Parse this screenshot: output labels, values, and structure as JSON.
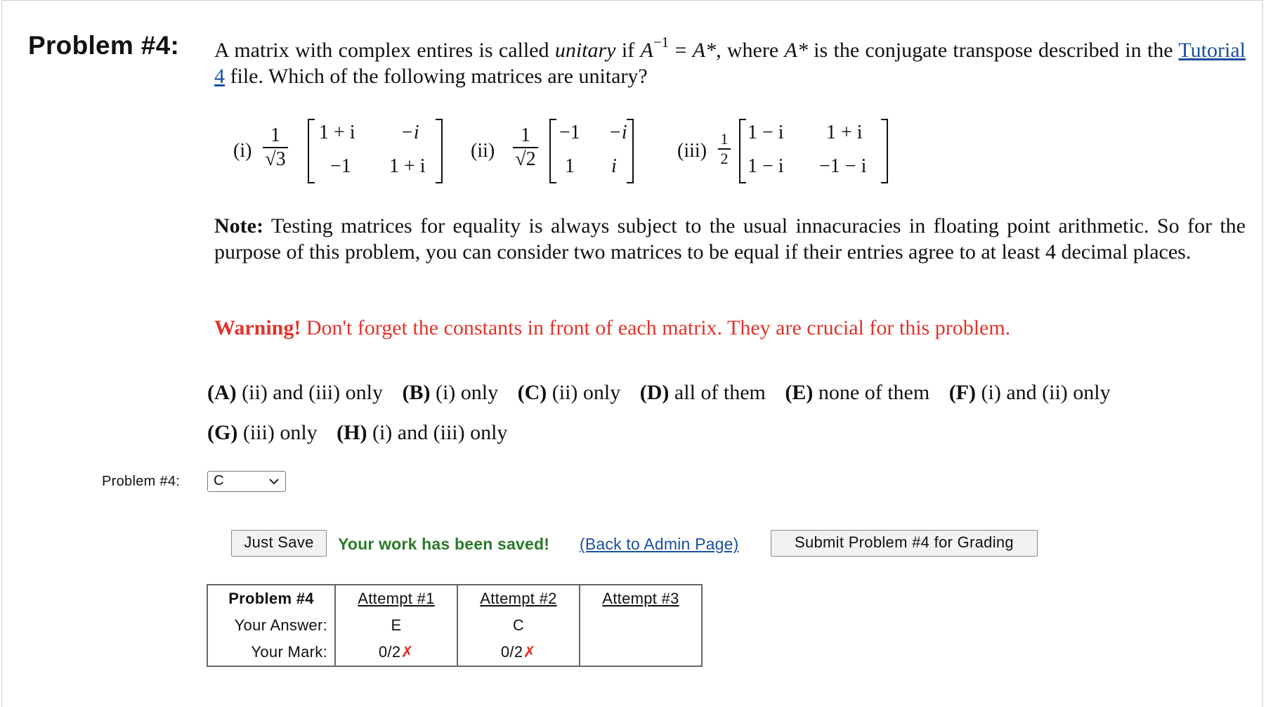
{
  "problem": {
    "label": "Problem #4:",
    "statement": {
      "p1": "A matrix with complex entires is called ",
      "unitary_word": "unitary",
      "p2": " if ",
      "A": "A",
      "inv_exp": "−1",
      "p3": " = ",
      "Astar1": "A*",
      "p4": ", where ",
      "Astar2": "A*",
      "p5": " is the conjugate transpose described in the ",
      "link": "Tutorial 4",
      "p6": " file. Which of the following matrices are unitary?"
    }
  },
  "matrices": [
    {
      "label": "(i)",
      "num": "1",
      "den": "√3",
      "cells": [
        "1 + i",
        "−i",
        "−1",
        "1 + i"
      ]
    },
    {
      "label": "(ii)",
      "num": "1",
      "den": "√2",
      "cells": [
        "−1",
        "−i",
        "1",
        "i"
      ]
    },
    {
      "label": "(iii)",
      "num": "1",
      "den": "2",
      "cells": [
        "1 − i",
        "1 + i",
        "1 − i",
        "−1 − i"
      ]
    }
  ],
  "note": {
    "bold": "Note:",
    "text": " Testing matrices for equality is always subject to the usual innacuracies in floating point arithmetic. So for the purpose of this problem, you can consider two matrices to be equal if their entries agree to at least 4 decimal places."
  },
  "warning": {
    "bold": "Warning!",
    "text": " Don't forget the constants in front of each matrix. They are crucial for this problem."
  },
  "choices": {
    "line1": [
      {
        "key": "(A)",
        "text": "(ii) and (iii) only"
      },
      {
        "key": "(B)",
        "text": "(i) only"
      },
      {
        "key": "(C)",
        "text": "(ii) only"
      },
      {
        "key": "(D)",
        "text": "all of them"
      },
      {
        "key": "(E)",
        "text": "none of them"
      },
      {
        "key": "(F)",
        "text": "(i) and (ii) only"
      }
    ],
    "line2": [
      {
        "key": "(G)",
        "text": "(iii) only"
      },
      {
        "key": "(H)",
        "text": "(i) and (iii) only"
      }
    ]
  },
  "answer": {
    "label": "Problem #4:",
    "selected": "C"
  },
  "actions": {
    "just_save": "Just Save",
    "saved_msg": "Your work has been saved!",
    "admin_link": "(Back to Admin Page)",
    "submit": "Submit Problem #4 for Grading"
  },
  "attempts_table": {
    "header": [
      "Problem #4",
      "Attempt #1",
      "Attempt #2",
      "Attempt #3"
    ],
    "answer_label": "Your Answer:",
    "answers": [
      "E",
      "C",
      ""
    ],
    "mark_label": "Your Mark:",
    "marks": [
      "0/2",
      "0/2",
      ""
    ],
    "wrong_mark": "✗"
  },
  "colors": {
    "warning": "#e0332a",
    "saved": "#2a7a2a",
    "link": "#1a4fa0"
  }
}
